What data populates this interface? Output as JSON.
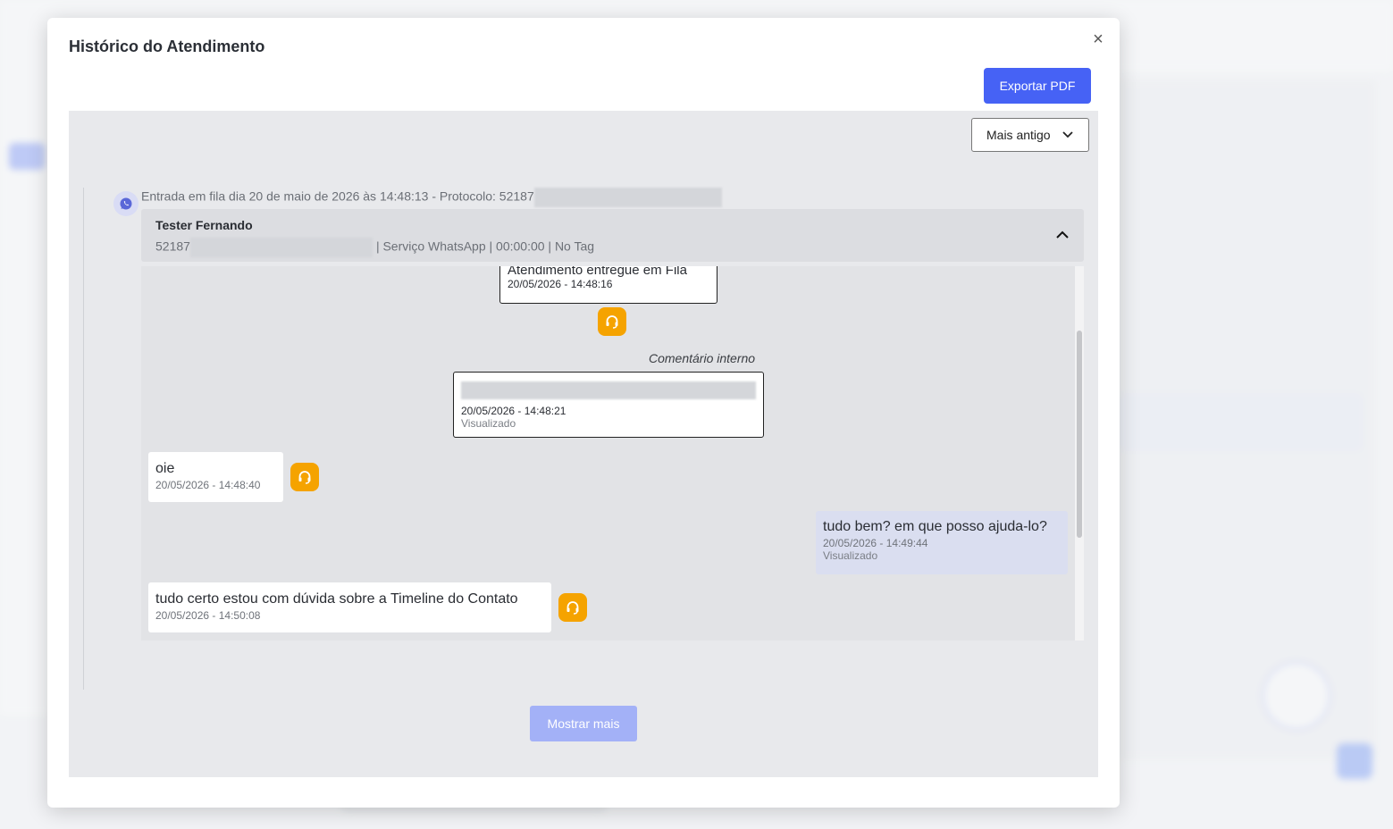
{
  "modal": {
    "title": "Histórico do Atendimento",
    "close_label": "×",
    "export_label": "Exportar PDF"
  },
  "sort": {
    "selected": "Mais antigo"
  },
  "entry": {
    "text": "Entrada em fila dia 20 de maio de 2026 às 14:48:13 - Protocolo: 52187"
  },
  "ticket": {
    "name": "Tester Fernando",
    "protocol_prefix": "52187",
    "service": "| Serviço WhatsApp | 00:00:00 | No Tag"
  },
  "events": [
    {
      "title": "Atendimento entregue em Fila",
      "time": "20/05/2026 - 14:48:16"
    }
  ],
  "comment": {
    "label": "Comentário interno",
    "time": "20/05/2026 - 14:48:21",
    "status": "Visualizado"
  },
  "messages": [
    {
      "direction": "in",
      "text": "oie",
      "time": "20/05/2026 - 14:48:40"
    },
    {
      "direction": "out",
      "text": "tudo bem? em que posso ajuda-lo?",
      "time": "20/05/2026 - 14:49:44",
      "status": "Visualizado"
    },
    {
      "direction": "in",
      "text": "tudo certo estou com dúvida sobre a Timeline do Contato",
      "time": "20/05/2026 - 14:50:08"
    }
  ],
  "show_more_label": "Mostrar mais",
  "colors": {
    "primary": "#4662f5",
    "agent_icon": "#f5a300",
    "outgoing_bubble": "#dadef0"
  }
}
